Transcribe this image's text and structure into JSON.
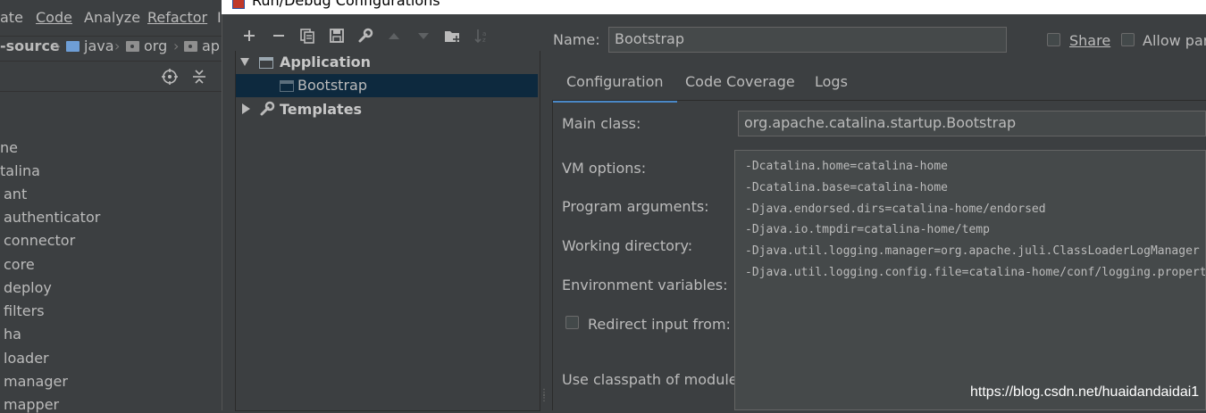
{
  "ide": {
    "menu": [
      "ate",
      "Code",
      "Analyze",
      "Refactor",
      "I"
    ],
    "breadcrumb": [
      "-source",
      "java",
      "org",
      "ap"
    ],
    "project_tree": [
      "ne",
      "talina",
      "ant",
      "authenticator",
      "connector",
      "core",
      "deploy",
      "filters",
      "ha",
      "loader",
      "manager",
      "mapper"
    ]
  },
  "dialog": {
    "title": "Run/Debug Configurations",
    "toolbar_icons": [
      "add-icon",
      "remove-icon",
      "copy-icon",
      "save-icon",
      "wrench-icon",
      "move-up-icon",
      "move-down-icon",
      "new-folder-icon",
      "sort-icon"
    ],
    "tree": {
      "application_label": "Application",
      "bootstrap_label": "Bootstrap",
      "templates_label": "Templates"
    },
    "name_label": "Name:",
    "name_value": "Bootstrap",
    "share_label": "Share",
    "allow_parallel_label": "Allow para",
    "tabs": [
      "Configuration",
      "Code Coverage",
      "Logs"
    ],
    "main_class_label": "Main class:",
    "main_class_value": "org.apache.catalina.startup.Bootstrap",
    "vm_options_label": "VM options:",
    "vm_options_lines": [
      "-Dcatalina.home=catalina-home",
      "-Dcatalina.base=catalina-home",
      "-Djava.endorsed.dirs=catalina-home/endorsed",
      "-Djava.io.tmpdir=catalina-home/temp",
      "-Djava.util.logging.manager=org.apache.juli.ClassLoaderLogManager",
      "-Djava.util.logging.config.file=catalina-home/conf/logging.properties"
    ],
    "program_args_label": "Program arguments:",
    "working_dir_label": "Working directory:",
    "env_vars_label": "Environment variables:",
    "redirect_input_label": "Redirect input from:",
    "classpath_module_label": "Use classpath of module:"
  },
  "watermark": "https://blog.csdn.net/huaidandaidai1",
  "colors": {
    "background": "#3c3f41",
    "field": "#45494a",
    "selection": "#0d293e",
    "tab_accent": "#4a88c7",
    "text": "#bbbbbb"
  }
}
